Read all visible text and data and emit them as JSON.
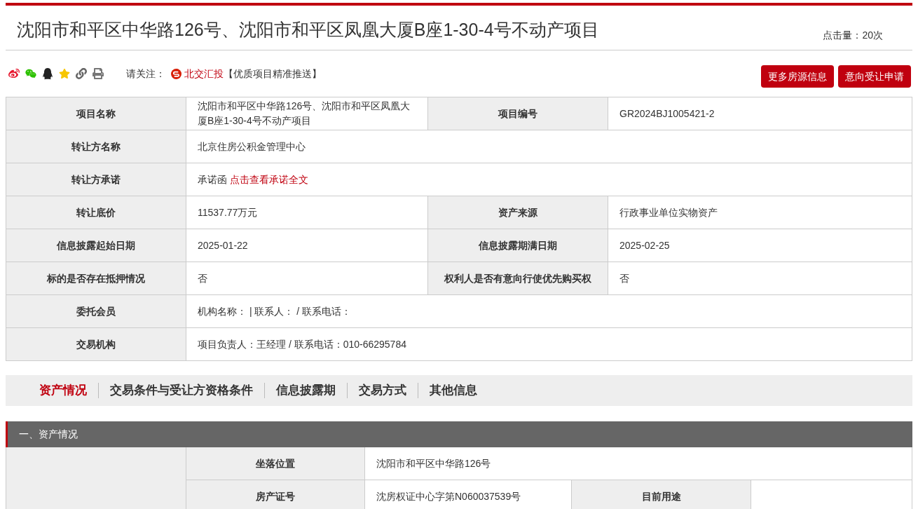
{
  "title": "沈阳市和平区中华路126号、沈阳市和平区凤凰大厦B座1-30-4号不动产项目",
  "clicks": "点击量：20次",
  "share": {
    "label": "请关注：",
    "brand": "北交汇投",
    "note": "【优质项目精准推送】"
  },
  "buttons": [
    "更多房源信息",
    "意向受让申请"
  ],
  "info_rows": [
    {
      "cells": [
        {
          "label": "项目名称",
          "value": "沈阳市和平区中华路126号、沈阳市和平区凤凰大厦B座1-30-4号不动产项目"
        },
        {
          "label": "项目编号",
          "value": "GR2024BJ1005421-2"
        }
      ]
    },
    {
      "cells": [
        {
          "label": "转让方名称",
          "value": "北京住房公积金管理中心"
        }
      ]
    },
    {
      "cells": [
        {
          "label": "转让方承诺",
          "value": "承诺函",
          "link": "点击查看承诺全文"
        }
      ]
    },
    {
      "cells": [
        {
          "label": "转让底价",
          "value": "11537.77万元"
        },
        {
          "label": "资产来源",
          "value": "行政事业单位实物资产"
        }
      ]
    },
    {
      "cells": [
        {
          "label": "信息披露起始日期",
          "value": "2025-01-22"
        },
        {
          "label": "信息披露期满日期",
          "value": "2025-02-25"
        }
      ]
    },
    {
      "cells": [
        {
          "label": "标的是否存在抵押情况",
          "value": "否"
        },
        {
          "label": "权利人是否有意向行使优先购买权",
          "value": "否"
        }
      ]
    },
    {
      "cells": [
        {
          "label": "委托会员",
          "value": "机构名称： | 联系人： / 联系电话："
        }
      ]
    },
    {
      "cells": [
        {
          "label": "交易机构",
          "value": "项目负责人：王经理 / 联系电话：010-66295784"
        }
      ]
    }
  ],
  "tabs": [
    {
      "label": "资产情况",
      "selected": true
    },
    {
      "label": "交易条件与受让方资格条件",
      "selected": false
    },
    {
      "label": "信息披露期",
      "selected": false
    },
    {
      "label": "交易方式",
      "selected": false
    },
    {
      "label": "其他信息",
      "selected": false
    }
  ],
  "section": {
    "title": "一、资产情况",
    "rows": [
      {
        "cells": [
          {
            "label": "坐落位置",
            "value": "沈阳市和平区中华路126号"
          }
        ]
      },
      {
        "cells": [
          {
            "label": "房产证号",
            "value": "沈房权证中心字第N060037539号"
          },
          {
            "label": "目前用途"
          }
        ]
      }
    ]
  }
}
